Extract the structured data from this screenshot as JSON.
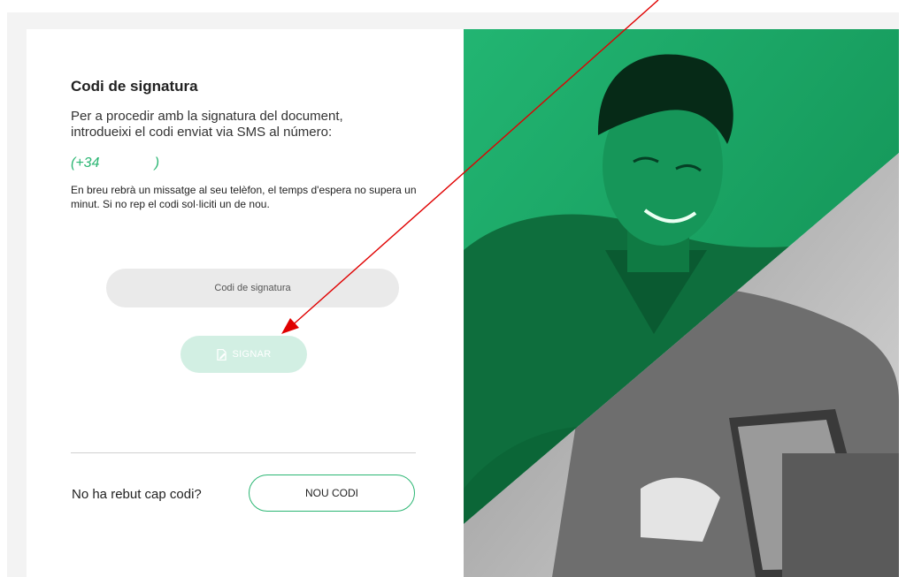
{
  "signature_panel": {
    "title": "Codi de signatura",
    "description": "Per a procedir amb la signatura del document, introdueixi el codi enviat via SMS al número:",
    "phone": "(+34              )",
    "info": "En breu rebrà un missatge al seu telèfon, el temps d'espera no supera un minut. Si no rep el codi sol·liciti un de nou.",
    "code_input": {
      "placeholder": "Codi de signatura",
      "value": ""
    },
    "sign_button": {
      "label": "SIGNAR",
      "icon": "document-sign-icon",
      "disabled": true
    },
    "no_code_text": "No ha rebut cap codi?",
    "new_code_button": "NOU CODI"
  },
  "colors": {
    "accent": "#2bb673",
    "sign_button_disabled": "#d2efe3",
    "input_background": "#eaeaea",
    "annotation_arrow": "#e00000"
  },
  "hero_image": {
    "description_icon": "person-with-tablet-image"
  }
}
